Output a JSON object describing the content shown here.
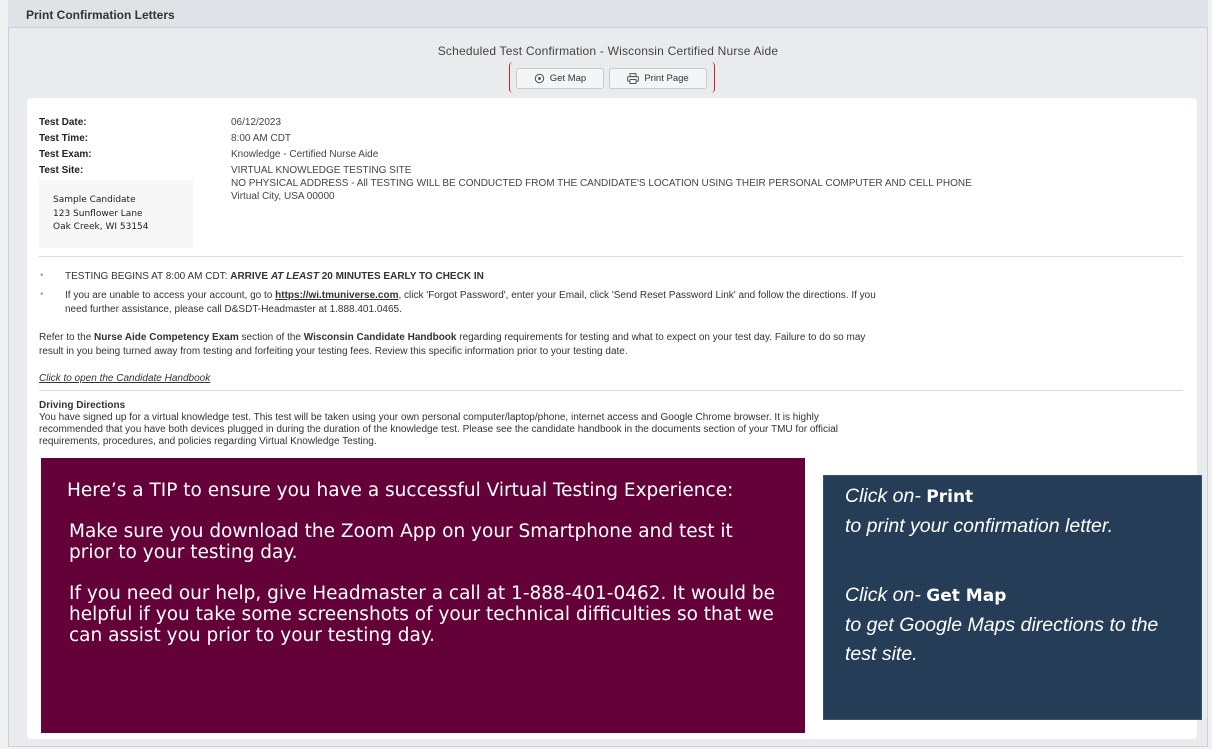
{
  "window": {
    "title": "Print Confirmation Letters"
  },
  "header": {
    "title": "Scheduled Test Confirmation - Wisconsin Certified Nurse Aide",
    "get_map_label": "Get Map",
    "print_page_label": "Print Page"
  },
  "test_info": {
    "date_label": "Test Date:",
    "date_value": "06/12/2023",
    "time_label": "Test Time:",
    "time_value": "8:00 AM CDT",
    "exam_label": "Test Exam:",
    "exam_value": "Knowledge - Certified Nurse Aide",
    "site_label": "Test Site:",
    "site_line1": "VIRTUAL KNOWLEDGE TESTING SITE",
    "site_line2": "NO PHYSICAL ADDRESS - All TESTING WILL BE CONDUCTED FROM THE CANDIDATE'S LOCATION USING THEIR PERSONAL COMPUTER AND CELL PHONE",
    "site_line3": "Virtual City, USA 00000"
  },
  "candidate": {
    "name": "Sample Candidate",
    "street": "123 Sunflower Lane",
    "city": "Oak Creek, WI 53154"
  },
  "notices": {
    "b1_prefix": "TESTING BEGINS AT 8:00 AM CDT:",
    "b1_bold1": "ARRIVE",
    "b1_italic": "AT LEAST",
    "b1_bold2": "20 MINUTES EARLY TO CHECK IN",
    "b2_prefix": "If you are unable to access your account, go to",
    "b2_link": "https://wi.tmuniverse.com",
    "b2_suffix": ", click 'Forgot Password', enter your Email, click 'Send Reset Password Link' and follow the directions.  If you",
    "b2_line2": "need further assistance, please call D&SDT-Headmaster at 1.888.401.0465.",
    "refer_1": "Refer to the",
    "refer_bold1": "Nurse Aide Competency Exam",
    "refer_2": "section of the",
    "refer_bold2": "Wisconsin Candidate Handbook",
    "refer_3": "regarding requirements for testing and what to expect on your test day.  Failure to do so may",
    "refer_line2": "result in you being turned away from testing and forfeiting your testing fees.  Review this specific information prior to your testing date.",
    "handbook_link": "Click to open the Candidate Handbook"
  },
  "directions": {
    "heading": "Driving Directions",
    "line1": "You have signed up for a virtual knowledge test. This test will be taken using your own personal computer/laptop/phone, internet access and Google Chrome browser. It is highly",
    "line2": "recommended that you have both devices plugged in during the duration of the knowledge test. Please see the candidate handbook in the documents section of your TMU for official",
    "line3": "requirements, procedures, and policies regarding Virtual Knowledge Testing."
  },
  "tip_box": {
    "p1": "Here’s a TIP to ensure you have a successful Virtual Testing Experience:",
    "p2": "Make sure you download the Zoom App on your Smartphone and test it prior to your testing day.",
    "p3": "If you need our help, give Headmaster a call at 1-888-401-0462. It would be helpful if you take some screenshots of your technical difficulties so that we can assist you prior to your testing day."
  },
  "hint_box": {
    "print_prefix": "Click on-",
    "print_word": "Print",
    "print_desc": "to print your confirmation letter.",
    "map_prefix": "Click on-",
    "map_word": "Get Map",
    "map_desc": "to get Google Maps directions to the test site."
  },
  "colors": {
    "tip_bg": "#640138",
    "hint_bg": "#253d57",
    "highlight_border": "#c2262e"
  }
}
